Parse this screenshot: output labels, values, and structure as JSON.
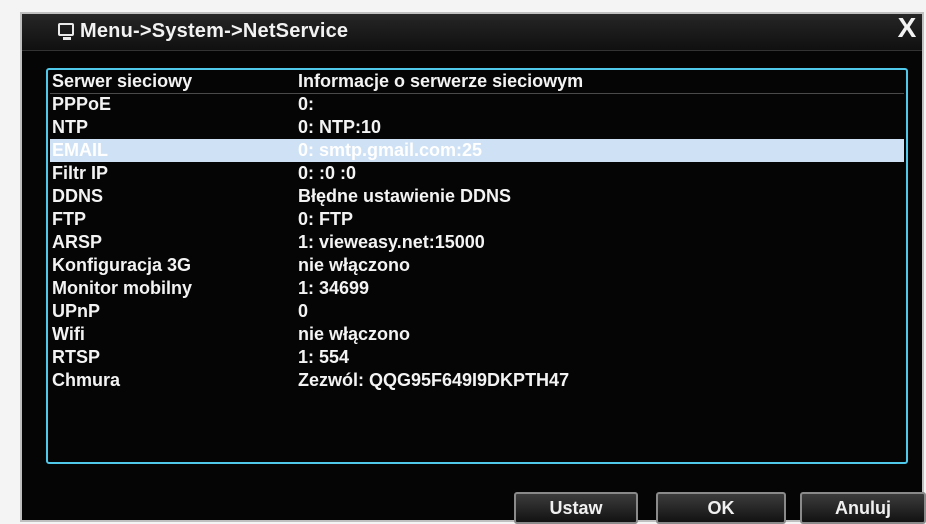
{
  "window": {
    "title": "Menu->System->NetService",
    "close_symbol": "X"
  },
  "table": {
    "headers": [
      "Serwer sieciowy",
      "Informacje o serwerze sieciowym"
    ],
    "rows": [
      {
        "name": "PPPoE",
        "info": "0:"
      },
      {
        "name": "NTP",
        "info": "0: NTP:10"
      },
      {
        "name": "EMAIL",
        "info": "0: smtp.gmail.com:25"
      },
      {
        "name": "Filtr IP",
        "info": "0: :0 :0"
      },
      {
        "name": "DDNS",
        "info": "Błędne ustawienie DDNS"
      },
      {
        "name": "FTP",
        "info": "0: FTP"
      },
      {
        "name": "ARSP",
        "info": "1: vieweasy.net:15000"
      },
      {
        "name": "Konfiguracja 3G",
        "info": "nie włączono"
      },
      {
        "name": "Monitor mobilny",
        "info": "1: 34699"
      },
      {
        "name": "UPnP",
        "info": "0"
      },
      {
        "name": "Wifi",
        "info": "nie włączono"
      },
      {
        "name": "RTSP",
        "info": "1: 554"
      },
      {
        "name": "Chmura",
        "info": "Zezwól: QQG95F649I9DKPTH47"
      }
    ],
    "selected_index": 2
  },
  "buttons": {
    "set": "Ustaw",
    "ok": "OK",
    "cancel": "Anuluj"
  },
  "colors": {
    "accent": "#50c8ea",
    "selected_row": "#cfe2f5",
    "background": "#050505"
  },
  "icons": {
    "title_icon": "monitor-icon",
    "close_icon": "close-icon"
  }
}
